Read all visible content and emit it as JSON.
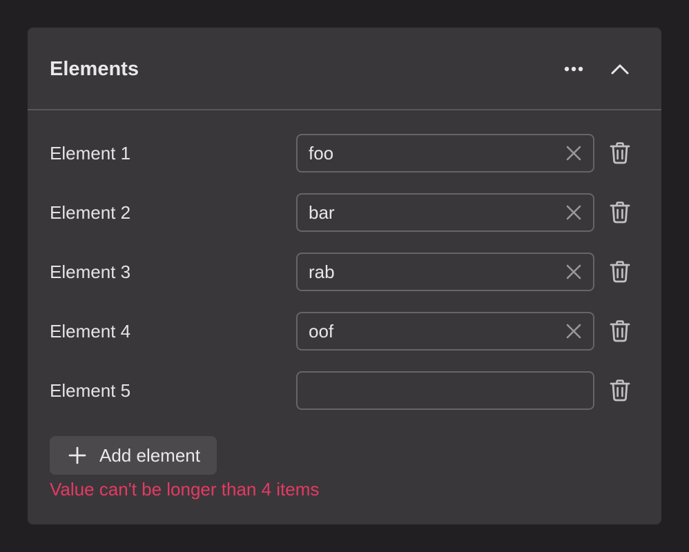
{
  "panel": {
    "title": "Elements"
  },
  "icons": {
    "more": "more-horizontal-icon",
    "collapse": "chevron-up-icon",
    "clear": "close-icon",
    "delete": "trash-icon",
    "add": "plus-icon"
  },
  "elements": [
    {
      "label": "Element 1",
      "value": "foo"
    },
    {
      "label": "Element 2",
      "value": "bar"
    },
    {
      "label": "Element 3",
      "value": "rab"
    },
    {
      "label": "Element 4",
      "value": "oof"
    },
    {
      "label": "Element 5",
      "value": ""
    }
  ],
  "add_button": {
    "label": "Add element"
  },
  "error": {
    "message": "Value can't be longer than 4 items"
  },
  "colors": {
    "background": "#221f23",
    "panel": "#3a373b",
    "border": "#67646a",
    "button": "#4c494d",
    "error": "#e53a63",
    "text": "#e9e6ea"
  }
}
